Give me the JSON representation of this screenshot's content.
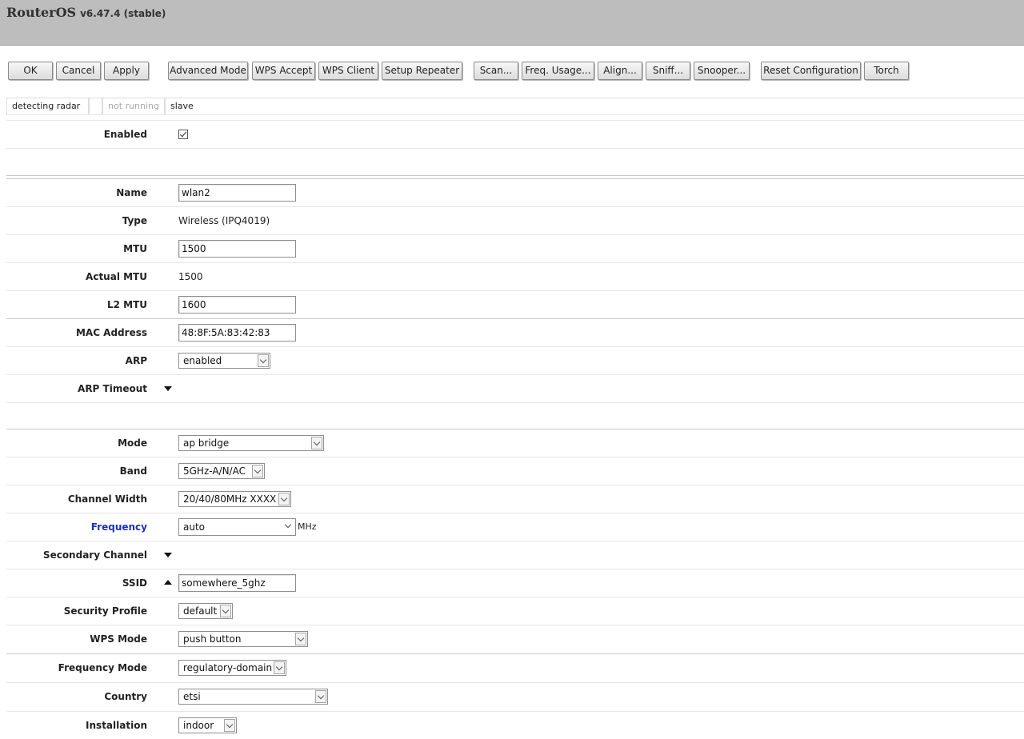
{
  "header": {
    "product": "RouterOS",
    "version": "v6.47.4 (stable)"
  },
  "toolbar": {
    "ok": "OK",
    "cancel": "Cancel",
    "apply": "Apply",
    "advanced_mode": "Advanced Mode",
    "wps_accept": "WPS Accept",
    "wps_client": "WPS Client",
    "setup_repeater": "Setup Repeater",
    "scan": "Scan...",
    "freq_usage": "Freq. Usage...",
    "align": "Align...",
    "sniff": "Sniff...",
    "snooper": "Snooper...",
    "reset_configuration": "Reset Configuration",
    "torch": "Torch"
  },
  "status": {
    "s1": "detecting radar",
    "s2": "",
    "s3": "not running",
    "s4": "slave"
  },
  "form": {
    "enabled": {
      "label": "Enabled",
      "checked": true
    },
    "name": {
      "label": "Name",
      "value": "wlan2"
    },
    "type": {
      "label": "Type",
      "value": "Wireless (IPQ4019)"
    },
    "mtu": {
      "label": "MTU",
      "value": "1500"
    },
    "actual_mtu": {
      "label": "Actual MTU",
      "value": "1500"
    },
    "l2_mtu": {
      "label": "L2 MTU",
      "value": "1600"
    },
    "mac_address": {
      "label": "MAC Address",
      "value": "48:8F:5A:83:42:83"
    },
    "arp": {
      "label": "ARP",
      "value": "enabled"
    },
    "arp_timeout": {
      "label": "ARP Timeout"
    },
    "mode": {
      "label": "Mode",
      "value": "ap bridge"
    },
    "band": {
      "label": "Band",
      "value": "5GHz-A/N/AC"
    },
    "channel_width": {
      "label": "Channel Width",
      "value": "20/40/80MHz XXXX"
    },
    "frequency": {
      "label": "Frequency",
      "value": "auto",
      "unit": "MHz"
    },
    "secondary_channel": {
      "label": "Secondary Channel"
    },
    "ssid": {
      "label": "SSID",
      "value": "somewhere_5ghz"
    },
    "security_profile": {
      "label": "Security Profile",
      "value": "default"
    },
    "wps_mode": {
      "label": "WPS Mode",
      "value": "push button"
    },
    "frequency_mode": {
      "label": "Frequency Mode",
      "value": "regulatory-domain"
    },
    "country": {
      "label": "Country",
      "value": "etsi"
    },
    "installation": {
      "label": "Installation",
      "value": "indoor"
    }
  },
  "colors": {
    "header_bg": "#bdbdbd",
    "link_label": "#1c2fb5"
  }
}
